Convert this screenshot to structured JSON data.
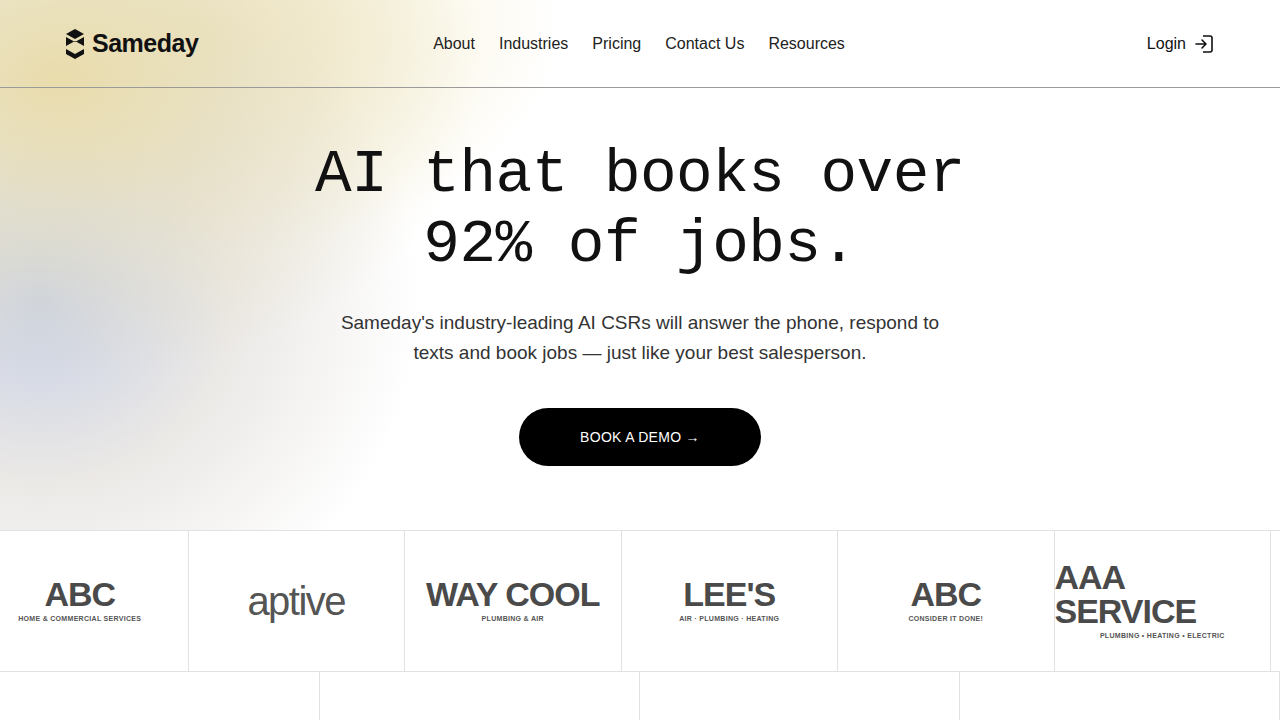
{
  "header": {
    "logo": "Sameday",
    "nav": [
      {
        "label": "About"
      },
      {
        "label": "Industries"
      },
      {
        "label": "Pricing"
      },
      {
        "label": "Contact Us"
      },
      {
        "label": "Resources"
      }
    ],
    "login": "Login"
  },
  "hero": {
    "title_lines": [
      "AI that books over",
      "92% of jobs."
    ],
    "subtitle": "Sameday's industry-leading AI CSRs will answer the phone, respond to texts and book jobs — just like your best salesperson.",
    "cta": "BOOK A DEMO →"
  },
  "clients": [
    {
      "name": "ABC",
      "tagline": "HOME & COMMERCIAL SERVICES"
    },
    {
      "name": "aptive"
    },
    {
      "name": "WAY COOL",
      "tagline": "PLUMBING & AIR"
    },
    {
      "name": "LEE'S",
      "tagline": "AIR · PLUMBING · HEATING"
    },
    {
      "name": "ABC",
      "tagline": "CONSIDER IT DONE!"
    },
    {
      "name": "AAA SERVICE",
      "tagline": "PLUMBING • HEATING • ELECTRIC"
    }
  ]
}
